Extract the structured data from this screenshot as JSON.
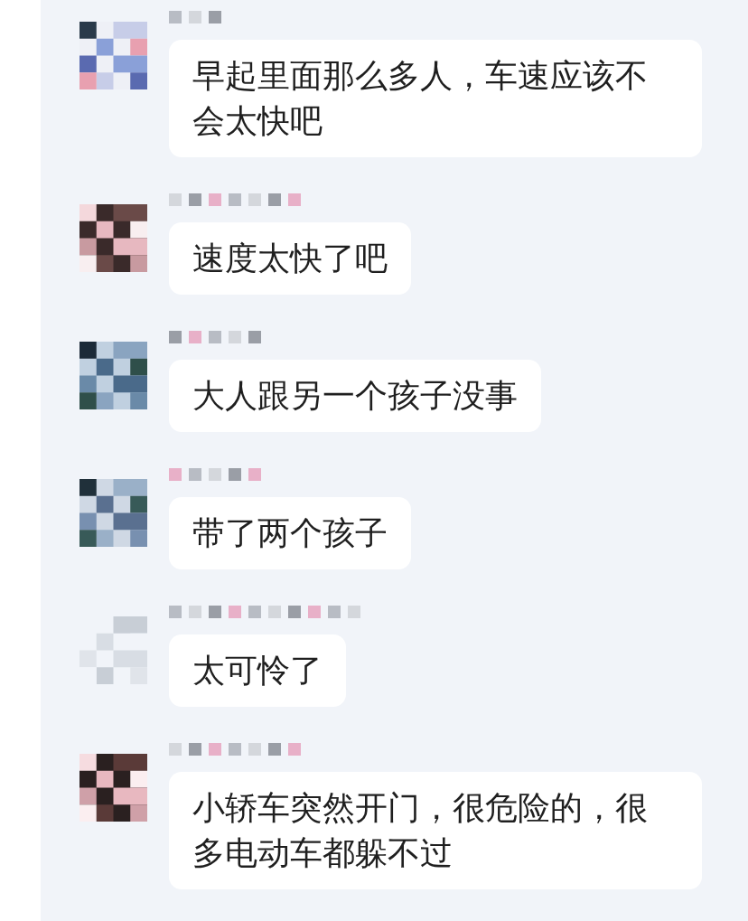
{
  "messages": [
    {
      "text": "早起里面那么多人，车速应该不会太快吧"
    },
    {
      "text": "速度太快了吧"
    },
    {
      "text": "大人跟另一个孩子没事"
    },
    {
      "text": "带了两个孩子"
    },
    {
      "text": "太可怜了"
    },
    {
      "text": "小轿车突然开门，很危险的，很多电动车都躲不过"
    }
  ]
}
